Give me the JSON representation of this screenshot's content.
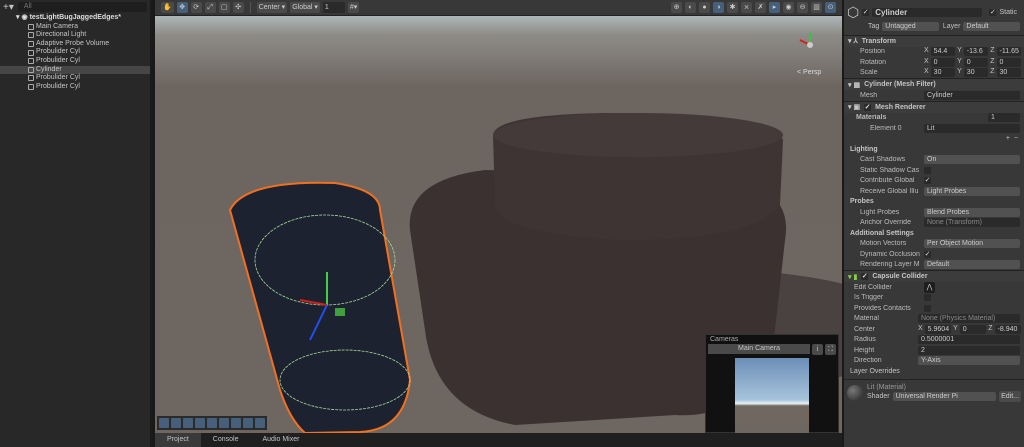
{
  "hierarchy": {
    "search_placeholder": "All",
    "scene": "testLightBugJaggedEdges*",
    "items": [
      "Main Camera",
      "Directional Light",
      "Adaptive Probe Volume",
      "Probulider Cyl",
      "Probulider Cyl",
      "Cylinder",
      "Probulider Cyl",
      "Probulider Cyl"
    ],
    "selected_index": 5
  },
  "toolbar": {
    "pivot": "Center",
    "space": "Global",
    "snap": "1"
  },
  "scene": {
    "persp_label": "< Persp",
    "colors": {
      "selection": "#f07020",
      "ground": "#6d6560"
    }
  },
  "cameras": {
    "title": "Cameras",
    "selected": "Main Camera"
  },
  "bottom_tabs": [
    "Project",
    "Console",
    "Audio Mixer"
  ],
  "inspector": {
    "name": "Cylinder",
    "static_label": "Static",
    "tag_label": "Tag",
    "tag": "Untagged",
    "layer_label": "Layer",
    "layer": "Default",
    "transform": {
      "title": "Transform",
      "position_label": "Position",
      "position": [
        "54.4",
        "-13.6",
        "-11.65"
      ],
      "rotation_label": "Rotation",
      "rotation": [
        "0",
        "0",
        "0"
      ],
      "scale_label": "Scale",
      "scale": [
        "30",
        "30",
        "30"
      ]
    },
    "mesh_filter": {
      "title": "Cylinder (Mesh Filter)",
      "mesh_label": "Mesh",
      "mesh": "Cylinder"
    },
    "mesh_renderer": {
      "title": "Mesh Renderer",
      "materials_label": "Materials",
      "materials_count": "1",
      "element_label": "Element 0",
      "element": "Lit",
      "lighting": "Lighting",
      "cast_shadows_label": "Cast Shadows",
      "cast_shadows": "On",
      "static_shadow_label": "Static Shadow Cas",
      "contribute_gi_label": "Contribute Global",
      "receive_gi_label": "Receive Global Illu",
      "receive_gi": "Light Probes",
      "probes": "Probes",
      "light_probes_label": "Light Probes",
      "light_probes": "Blend Probes",
      "anchor_label": "Anchor Override",
      "anchor": "None (Transform)",
      "additional": "Additional Settings",
      "motion_label": "Motion Vectors",
      "motion": "Per Object Motion",
      "occlusion_label": "Dynamic Occlusion",
      "rendering_layer_label": "Rendering Layer M",
      "rendering_layer": "Default"
    },
    "capsule": {
      "title": "Capsule Collider",
      "edit_label": "Edit Collider",
      "trigger_label": "Is Trigger",
      "contacts_label": "Provides Contacts",
      "material_label": "Material",
      "material": "None (Physics Material)",
      "center_label": "Center",
      "center": [
        "5.9604",
        "0",
        "-8.940"
      ],
      "radius_label": "Radius",
      "radius": "0.5000001",
      "height_label": "Height",
      "height": "2",
      "direction_label": "Direction",
      "direction": "Y-Axis",
      "layer_overrides": "Layer Overrides"
    },
    "material": {
      "title": "Lit (Material)",
      "shader_label": "Shader",
      "shader": "Universal Render Pi",
      "edit": "Edit..."
    }
  }
}
